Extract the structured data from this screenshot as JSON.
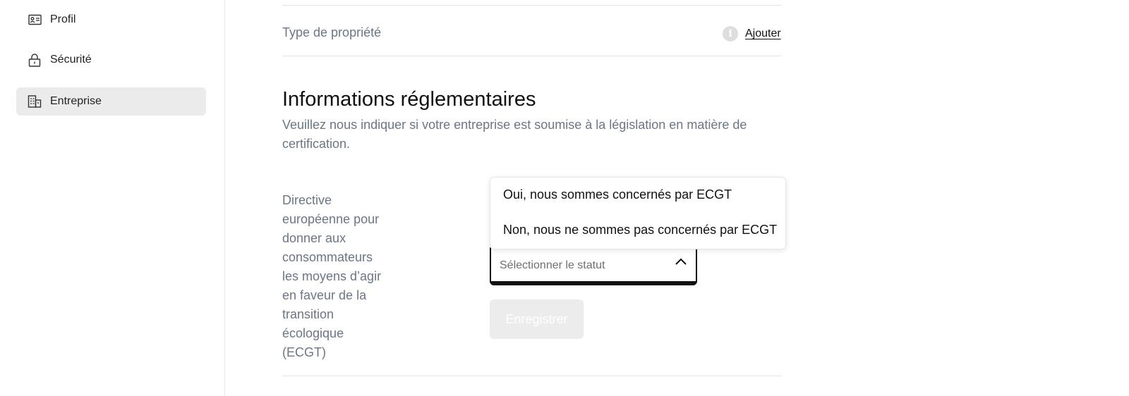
{
  "sidebar": {
    "items": [
      {
        "label": "Profil",
        "icon": "id-card-icon",
        "active": false
      },
      {
        "label": "Sécurité",
        "icon": "lock-icon",
        "active": false
      },
      {
        "label": "Entreprise",
        "icon": "building-icon",
        "active": true
      }
    ]
  },
  "property_row": {
    "label": "Type de propriété",
    "info_icon": "i",
    "action": "Ajouter"
  },
  "regulatory": {
    "title": "Informations réglementaires",
    "description": "Veuillez nous indiquer si votre entreprise est soumise à la législation en matière de certification.",
    "field_label": "Directive européenne pour donner aux consommateurs les moyens d’agir en faveur de la transition écologique (ECGT)",
    "select": {
      "placeholder": "Sélectionner le statut",
      "options": [
        "Oui, nous sommes concernés par ECGT",
        "Non, nous ne sommes pas concernés par ECGT"
      ]
    },
    "save_label": "Enregistrer"
  },
  "colors": {
    "muted_text": "#6b7687",
    "active_bg": "#ebebeb",
    "disabled_button": "#ececec"
  }
}
